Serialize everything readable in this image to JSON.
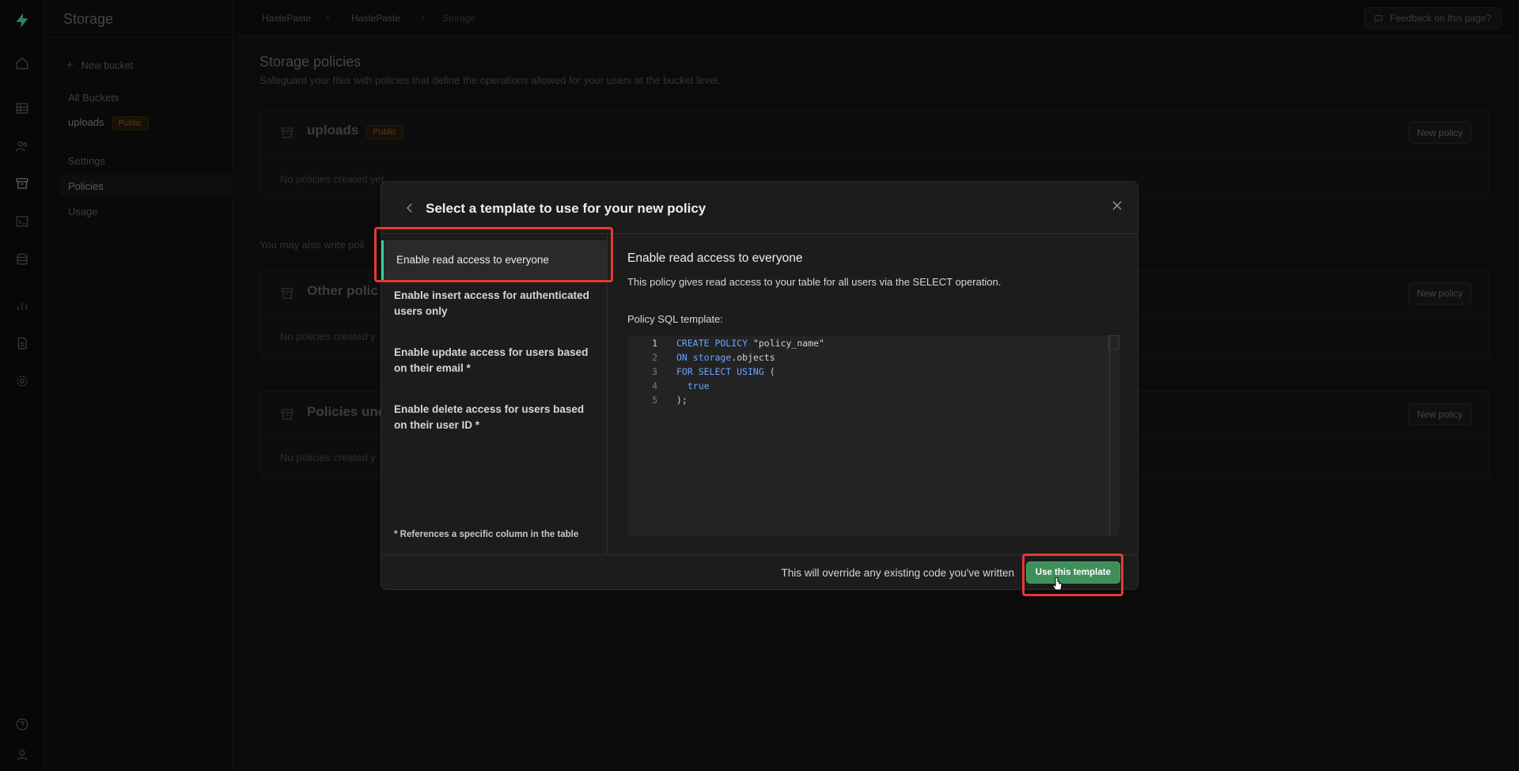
{
  "sidebar": {
    "title": "Storage",
    "new_bucket": "New bucket",
    "all_buckets": "All Buckets",
    "bucket_name": "uploads",
    "bucket_badge": "Public",
    "settings": "Settings",
    "policies": "Policies",
    "usage": "Usage"
  },
  "breadcrumb": [
    "HastePaste",
    "HastePaste",
    "Storage"
  ],
  "topbar": {
    "feedback": "Feedback on this page?"
  },
  "main": {
    "title": "Storage policies",
    "subtitle": "Safeguard your files with policies that define the operations allowed for your users at the bucket level.",
    "cards": [
      {
        "title": "uploads",
        "badge": "Public",
        "empty": "No policies created yet",
        "button": "New policy"
      },
      {
        "title": "Other polic",
        "empty": "No policies created y",
        "button": "New policy"
      },
      {
        "title": "Policies unc",
        "empty": "No policies created y",
        "button": "New policy"
      }
    ],
    "also_write": "You may also write poli"
  },
  "modal": {
    "title": "Select a template to use for your new policy",
    "templates": [
      "Enable read access to everyone",
      "Enable insert access for authenticated users only",
      "Enable update access for users based on their email *",
      "Enable delete access for users based on their user ID *"
    ],
    "note": "* References a specific column in the table",
    "detail_title": "Enable read access to everyone",
    "detail_desc": "This policy gives read access to your table for all users via the SELECT operation.",
    "sql_label": "Policy SQL template:",
    "code_lines": [
      "CREATE POLICY \"policy_name\"",
      "ON storage.objects",
      "FOR SELECT USING (",
      "  true",
      ");"
    ],
    "line_numbers": [
      "1",
      "2",
      "3",
      "4",
      "5"
    ],
    "footer_warning": "This will override any existing code you've written",
    "use_button": "Use this template"
  },
  "colors": {
    "accent": "#3ecf8e",
    "button": "#3e8f5a",
    "highlight": "#e53935"
  }
}
